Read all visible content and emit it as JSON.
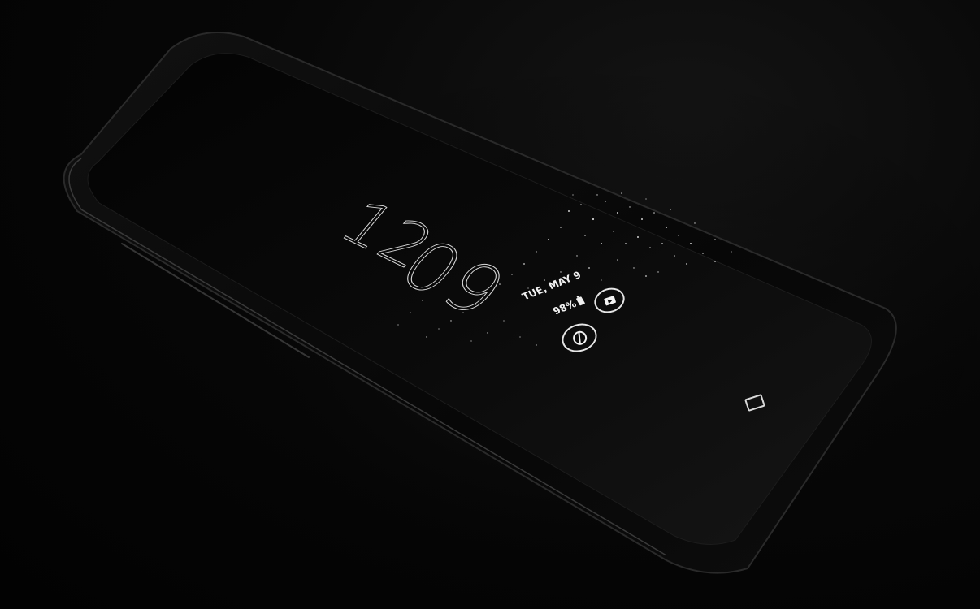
{
  "lock_screen": {
    "clock_hour": "12",
    "clock_minute": "09",
    "date": "TUE, MAY 9",
    "battery_percent": "98%"
  },
  "icons": {
    "battery": "battery-icon",
    "media": "media-play-icon",
    "power": "power-saving-icon",
    "home": "home-button-icon"
  },
  "colors": {
    "background": "#050505",
    "phone_body": "#0c0c0c",
    "aod_text": "#e8e8e8"
  }
}
